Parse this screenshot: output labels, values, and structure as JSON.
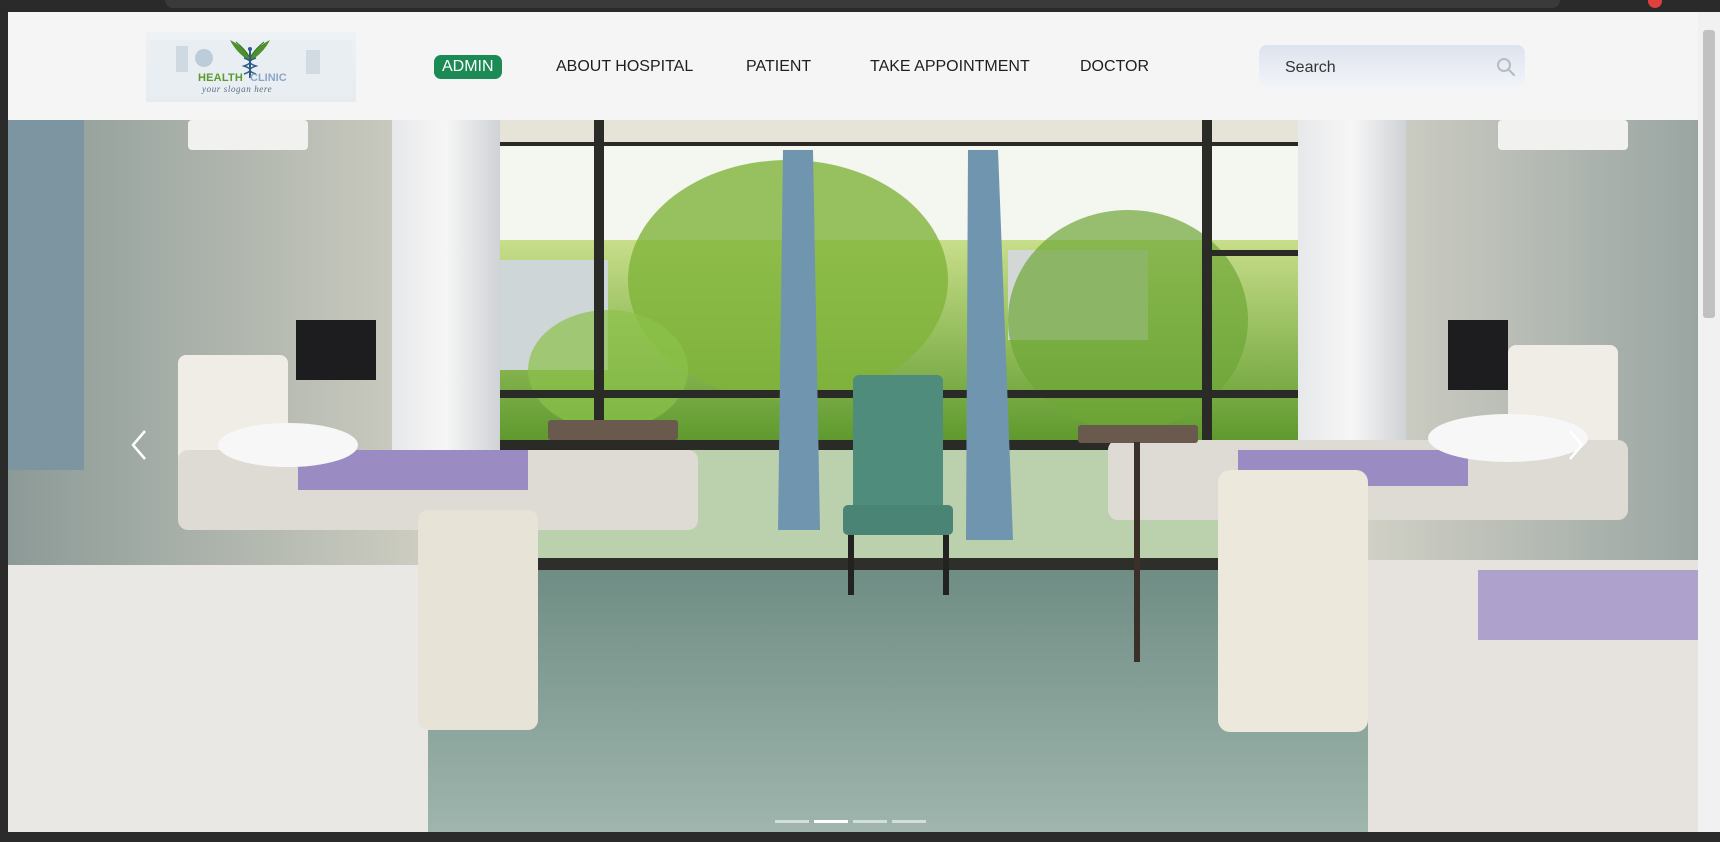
{
  "logo": {
    "brand_part1": "HEALTH",
    "brand_part2": "CLINIC",
    "slogan": "your slogan here"
  },
  "nav": {
    "items": [
      {
        "label": "ADMIN",
        "active": true
      },
      {
        "label": "ABOUT HOSPITAL",
        "active": false
      },
      {
        "label": "PATIENT",
        "active": false
      },
      {
        "label": "TAKE APPOINTMENT",
        "active": false
      },
      {
        "label": "DOCTOR",
        "active": false
      }
    ]
  },
  "search": {
    "placeholder": "Search",
    "icon": "search-icon"
  },
  "carousel": {
    "slide_count": 4,
    "active_slide": 2,
    "prev_icon": "chevron-left-icon",
    "next_icon": "chevron-right-icon",
    "image_subject": "hospital ward with beds and window"
  },
  "colors": {
    "accent_green": "#1c8a55",
    "logo_green": "#5a9b2b",
    "logo_blue": "#8aa8c6"
  }
}
